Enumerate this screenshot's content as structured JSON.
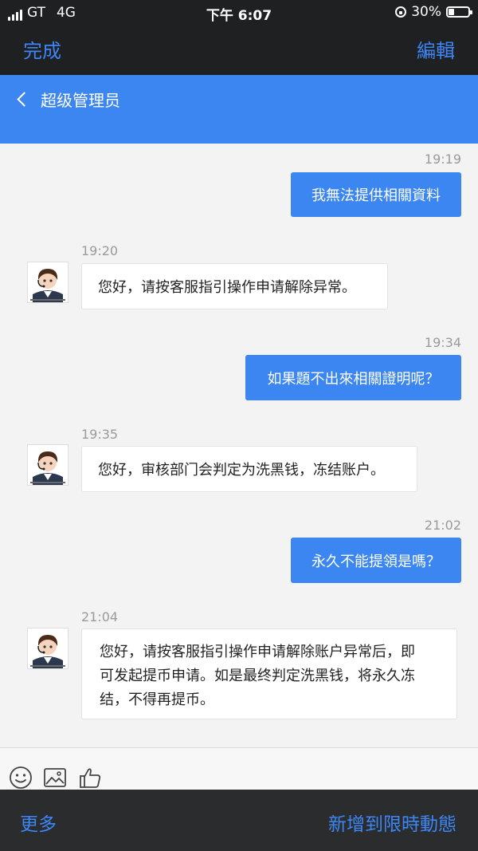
{
  "status_bar": {
    "carrier": "GT",
    "network": "4G",
    "time": "下午 6:07",
    "battery_percent": "30%",
    "battery_level": 0.3
  },
  "toolbar": {
    "done_label": "完成",
    "edit_label": "編輯"
  },
  "chat_header": {
    "title": "超级管理员"
  },
  "messages": [
    {
      "direction": "outgoing",
      "time": "19:19",
      "text": "我無法提供相關資料"
    },
    {
      "direction": "incoming",
      "time": "19:20",
      "text": "您好，请按客服指引操作申请解除异常。"
    },
    {
      "direction": "outgoing",
      "time": "19:34",
      "text": "如果題不出來相關證明呢？"
    },
    {
      "direction": "incoming",
      "time": "19:35",
      "text": "您好，审核部门会判定为洗黑钱，冻结账户。"
    },
    {
      "direction": "outgoing",
      "time": "21:02",
      "text": "永久不能提領是嗎？"
    },
    {
      "direction": "incoming",
      "time": "21:04",
      "lines": [
        "您好，请按客服指引操作申请解除账户异常后，即",
        "可发起提币申请。如是最终判定洗黑钱，将永久冻",
        "结，不得再提币。"
      ]
    }
  ],
  "input_toolbar": {
    "icons": [
      "emoji-icon",
      "image-icon",
      "thumbs-up-icon"
    ]
  },
  "bottom_bar": {
    "more_label": "更多",
    "share_label": "新增到限時動態"
  },
  "colors": {
    "accent": "#3b86f0",
    "dark_bar": "#1f2022",
    "chat_bg": "#f3f3f3"
  }
}
